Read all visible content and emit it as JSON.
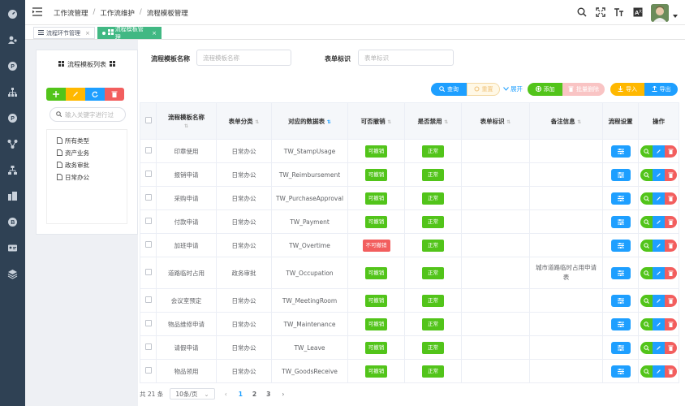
{
  "breadcrumb": [
    "工作流管理",
    "工作流维护",
    "流程模板管理"
  ],
  "tabs": [
    {
      "label": "流程环节管理",
      "close": "×"
    },
    {
      "label": "流程模板管理",
      "close": "×"
    }
  ],
  "tree": {
    "title": "流程模板列表",
    "search_placeholder": "输入关键字进行过",
    "items": [
      "所有类型",
      "资产业务",
      "政务审批",
      "日常办公"
    ]
  },
  "filters": {
    "name_label": "流程模板名称",
    "name_placeholder": "流程模板名称",
    "form_label": "表单标识",
    "form_placeholder": "表单标识"
  },
  "actions": {
    "query": "查询",
    "reset": "重置",
    "expand": "展开",
    "add": "添加",
    "batch_delete": "批量删除",
    "import": "导入",
    "export": "导出"
  },
  "table": {
    "headers": [
      "流程模板名称",
      "表单分类",
      "对应的数据表",
      "可否撤销",
      "是否禁用",
      "表单标识",
      "备注信息",
      "流程设置",
      "操作"
    ],
    "rows": [
      {
        "name": "印章使用",
        "category": "日常办公",
        "table": "TW_StampUsage",
        "revocable": "可撤销",
        "revocable_ok": true,
        "status": "正常",
        "form_id": "",
        "remark": ""
      },
      {
        "name": "报销申请",
        "category": "日常办公",
        "table": "TW_Reimbursement",
        "revocable": "可撤销",
        "revocable_ok": true,
        "status": "正常",
        "form_id": "",
        "remark": ""
      },
      {
        "name": "采购申请",
        "category": "日常办公",
        "table": "TW_PurchaseApproval",
        "revocable": "可撤销",
        "revocable_ok": true,
        "status": "正常",
        "form_id": "",
        "remark": ""
      },
      {
        "name": "付款申请",
        "category": "日常办公",
        "table": "TW_Payment",
        "revocable": "可撤销",
        "revocable_ok": true,
        "status": "正常",
        "form_id": "",
        "remark": ""
      },
      {
        "name": "加班申请",
        "category": "日常办公",
        "table": "TW_Overtime",
        "revocable": "不可撤销",
        "revocable_ok": false,
        "status": "正常",
        "form_id": "",
        "remark": ""
      },
      {
        "name": "道路临时占用",
        "category": "政务审批",
        "table": "TW_Occupation",
        "revocable": "可撤销",
        "revocable_ok": true,
        "status": "正常",
        "form_id": "",
        "remark": "城市道路临时占用申请表"
      },
      {
        "name": "会议室预定",
        "category": "日常办公",
        "table": "TW_MeetingRoom",
        "revocable": "可撤销",
        "revocable_ok": true,
        "status": "正常",
        "form_id": "",
        "remark": ""
      },
      {
        "name": "物品维修申请",
        "category": "日常办公",
        "table": "TW_Maintenance",
        "revocable": "可撤销",
        "revocable_ok": true,
        "status": "正常",
        "form_id": "",
        "remark": ""
      },
      {
        "name": "请假申请",
        "category": "日常办公",
        "table": "TW_Leave",
        "revocable": "可撤销",
        "revocable_ok": true,
        "status": "正常",
        "form_id": "",
        "remark": ""
      },
      {
        "name": "物品领用",
        "category": "日常办公",
        "table": "TW_GoodsReceive",
        "revocable": "可撤销",
        "revocable_ok": true,
        "status": "正常",
        "form_id": "",
        "remark": ""
      }
    ]
  },
  "pagination": {
    "total": "共 21 条",
    "page_size": "10条/页",
    "pages": [
      "1",
      "2",
      "3"
    ],
    "current": "1"
  },
  "colors": {
    "sidebar": "#2f4154",
    "green": "#52c41a",
    "blue": "#1e9fff",
    "red": "#f25e5e",
    "orange": "#ffb800"
  }
}
